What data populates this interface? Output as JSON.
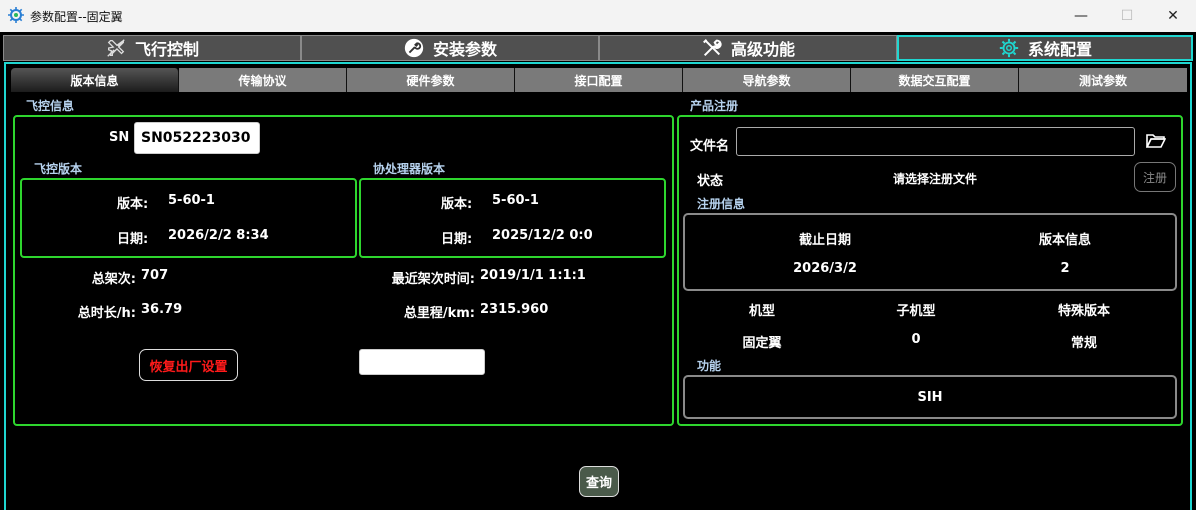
{
  "window": {
    "title": "参数配置--固定翼",
    "min_icon": "minimize-icon",
    "max_icon": "maximize-icon",
    "close_icon": "close-icon",
    "min_glyph": "—",
    "max_glyph": "☐",
    "close_glyph": "✕"
  },
  "main_tabs": [
    {
      "label": "飞行控制",
      "icon": "airplane-icon"
    },
    {
      "label": "安装参数",
      "icon": "wrench-circle-icon"
    },
    {
      "label": "高级功能",
      "icon": "tools-icon"
    },
    {
      "label": "系统配置",
      "icon": "gear-icon",
      "active": true
    }
  ],
  "sub_tabs": [
    {
      "label": "版本信息",
      "active": true
    },
    {
      "label": "传输协议"
    },
    {
      "label": "硬件参数"
    },
    {
      "label": "接口配置"
    },
    {
      "label": "导航参数"
    },
    {
      "label": "数据交互配置"
    },
    {
      "label": "测试参数"
    }
  ],
  "flight_info": {
    "section_title": "飞控信息",
    "sn_label": "SN",
    "sn_value": "SN052223030",
    "fc_version": {
      "title": "飞控版本",
      "version_label": "版本:",
      "version_value": "5-60-1",
      "date_label": "日期:",
      "date_value": "2026/2/2 8:34"
    },
    "coproc_version": {
      "title": "协处理器版本",
      "version_label": "版本:",
      "version_value": "5-60-1",
      "date_label": "日期:",
      "date_value": "2025/12/2 0:0"
    },
    "total_sorties_label": "总架次:",
    "total_sorties_value": "707",
    "last_sortie_label": "最近架次时间:",
    "last_sortie_value": "2019/1/1 1:1:1",
    "total_hours_label": "总时长/h:",
    "total_hours_value": "36.79",
    "total_km_label": "总里程/km:",
    "total_km_value": "2315.960",
    "reset_button": "恢复出厂设置",
    "extra_input_value": ""
  },
  "product_registration": {
    "section_title": "产品注册",
    "filename_label": "文件名",
    "filename_value": "",
    "status_label": "状态",
    "status_value": "请选择注册文件",
    "register_button": "注册",
    "reg_info_title": "注册信息",
    "expiry_label": "截止日期",
    "expiry_value": "2026/3/2",
    "version_info_label": "版本信息",
    "version_info_value": "2",
    "model_label": "机型",
    "model_value": "固定翼",
    "submodel_label": "子机型",
    "submodel_value": "0",
    "special_label": "特殊版本",
    "special_value": "常规",
    "function_title": "功能",
    "function_value": "SIH"
  },
  "query_button": "查询",
  "colors": {
    "accent": "#1fd6d0",
    "box_border": "#2ed62e",
    "section_label": "#b6d2ee",
    "reset_text": "#ff1a1a"
  }
}
